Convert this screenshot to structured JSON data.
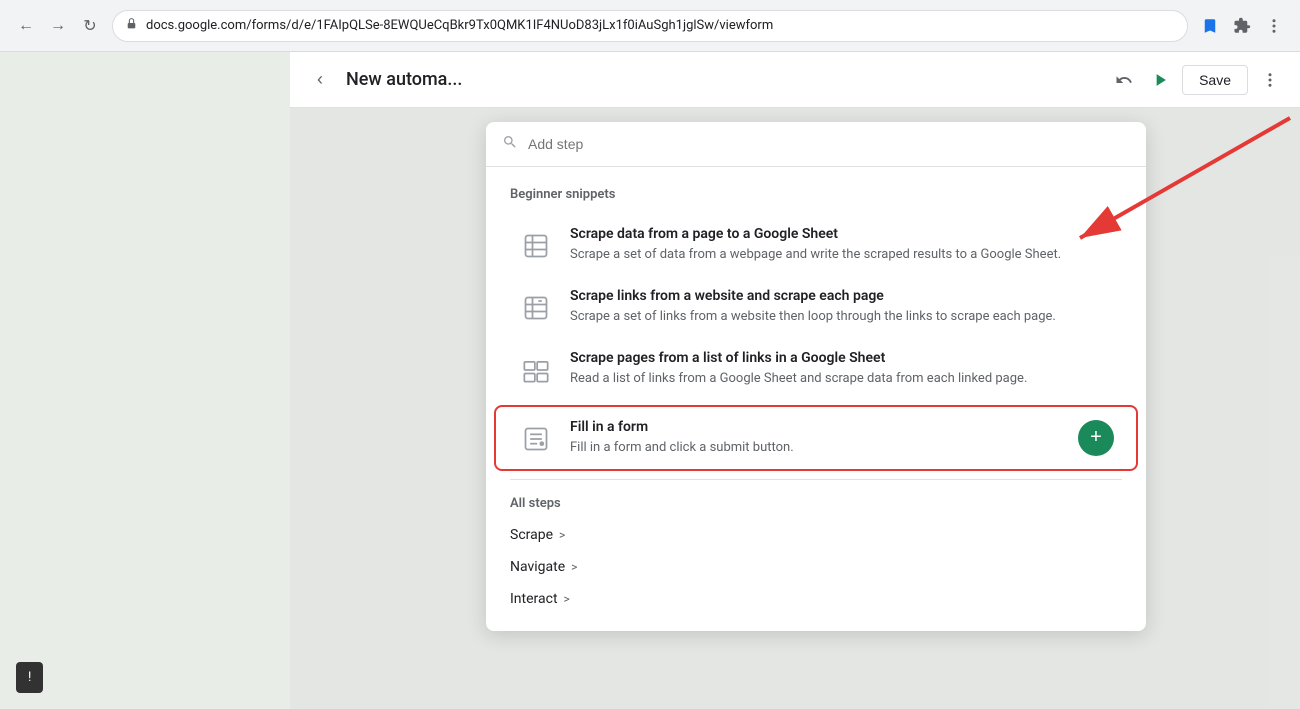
{
  "browser": {
    "url": "docs.google.com/forms/d/e/1FAIpQLSe-8EWQUeCqBkr9Tx0QMK1IF4NUoD83jLx1f0iAuSgh1jglSw/viewform",
    "back_disabled": false,
    "forward_disabled": false
  },
  "header": {
    "title": "New automa...",
    "save_label": "Save"
  },
  "search": {
    "placeholder": "Add step"
  },
  "beginner_snippets": {
    "label": "Beginner snippets",
    "items": [
      {
        "title": "Scrape data from a page to a Google Sheet",
        "description": "Scrape a set of data from a webpage and write the scraped results to a Google Sheet.",
        "icon": "table-icon"
      },
      {
        "title": "Scrape links from a website and scrape each page",
        "description": "Scrape a set of links from a website then loop through the links to scrape each page.",
        "icon": "table-icon"
      },
      {
        "title": "Scrape pages from a list of links in a Google Sheet",
        "description": "Read a list of links from a Google Sheet and scrape data from each linked page.",
        "icon": "table-icon"
      },
      {
        "title": "Fill in a form",
        "description": "Fill in a form and click a submit button.",
        "icon": "form-icon",
        "highlighted": true
      }
    ]
  },
  "all_steps": {
    "label": "All steps",
    "categories": [
      {
        "name": "Scrape"
      },
      {
        "name": "Navigate"
      },
      {
        "name": "Interact"
      }
    ]
  },
  "add_button_label": "+",
  "error_badge": "!"
}
